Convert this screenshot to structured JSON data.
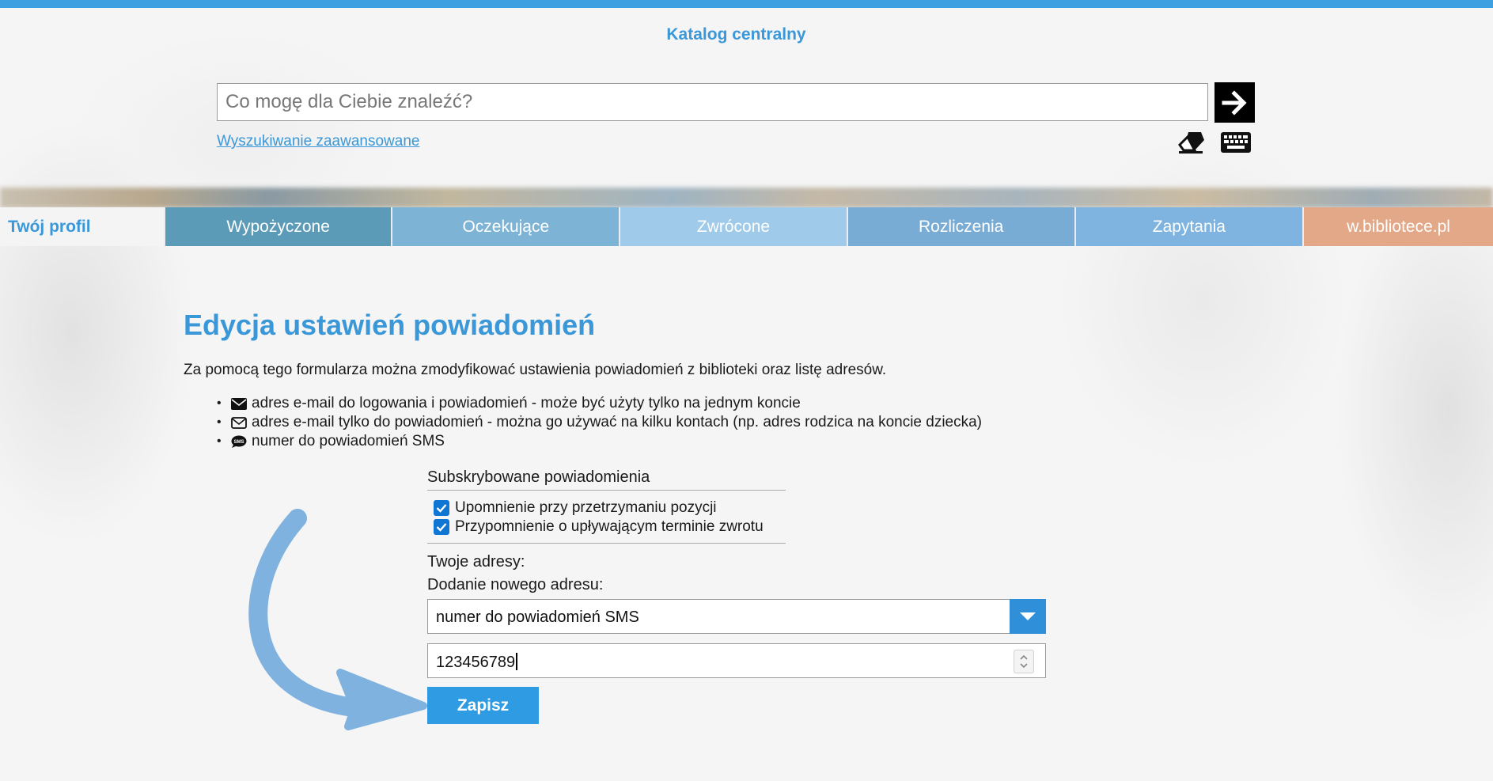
{
  "header": {
    "title": "Katalog centralny",
    "search_placeholder": "Co mogę dla Ciebie znaleźć?",
    "search_button_icon": "arrow-right-icon",
    "advanced_search_label": "Wyszukiwanie zaawansowane",
    "tool_icons": [
      "eraser-icon",
      "keyboard-icon"
    ]
  },
  "nav": {
    "tabs": [
      {
        "label": "Twój profil",
        "color": "#f4f4f4",
        "active": true
      },
      {
        "label": "Wypożyczone",
        "color": "#5b9bb8"
      },
      {
        "label": "Oczekujące",
        "color": "#7db3d5"
      },
      {
        "label": "Zwrócone",
        "color": "#9fcaea"
      },
      {
        "label": "Rozliczenia",
        "color": "#79acd5"
      },
      {
        "label": "Zapytania",
        "color": "#7eb4df"
      },
      {
        "label": "w.bibliotece.pl",
        "color": "#e3a887"
      }
    ]
  },
  "main": {
    "heading": "Edycja ustawień powiadomień",
    "intro": "Za pomocą tego formularza można zmodyfikować ustawienia powiadomień z biblioteki oraz listę adresów.",
    "bullets": [
      {
        "icon": "envelope-filled-icon",
        "text": "adres e-mail do logowania i powiadomień - może być użyty tylko na jednym koncie"
      },
      {
        "icon": "envelope-outline-icon",
        "text": "adres e-mail tylko do powiadomień - można go używać na kilku kontach (np. adres rodzica na koncie dziecka)"
      },
      {
        "icon": "sms-bubble-icon",
        "text": "numer do powiadomień SMS"
      }
    ],
    "subscriptions": {
      "title": "Subskrybowane powiadomienia",
      "items": [
        {
          "label": "Upomnienie przy przetrzymaniu pozycji",
          "checked": true
        },
        {
          "label": "Przypomnienie o upływającym terminie zwrotu",
          "checked": true
        }
      ]
    },
    "addresses_label": "Twoje adresy:",
    "add_address_label": "Dodanie nowego adresu:",
    "address_type_selected": "numer do powiadomień SMS",
    "phone_value": "123456789",
    "save_label": "Zapisz"
  },
  "colors": {
    "accent": "#3a97d8",
    "button": "#2f9be3",
    "checkbox": "#0f77d3",
    "annotation_arrow": "#7fb2df"
  }
}
